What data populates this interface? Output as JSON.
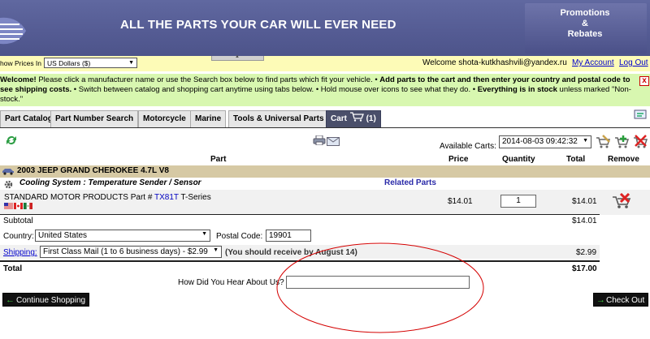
{
  "header": {
    "headline": "ALL THE PARTS YOUR CAR WILL EVER NEED",
    "promo": [
      "Promotions",
      "&",
      "Rebates"
    ]
  },
  "topbar": {
    "show_prices_label": "how Prices In",
    "currency_value": "US Dollars ($)",
    "welcome": "Welcome shota-kutkhashvili@yandex.ru",
    "my_account": "My Account",
    "log_out": "Log Out"
  },
  "banner": {
    "welcome_bold": "Welcome!",
    "text1": " Please click a manufacturer name or use the Search box below to find parts which fit your vehicle. • ",
    "bold2": "Add parts to the cart and then enter your country and postal code to see shipping costs.",
    "text2": " • Switch between catalog and shopping cart anytime using tabs below. • Hold mouse over icons to see what they do. • ",
    "bold3": "Everything is in stock",
    "text3": " unless marked \"Non-stock.\"",
    "close": "x"
  },
  "tabs": [
    "Part Catalog",
    "Part Number Search",
    "Motorcycle",
    "Marine",
    "Tools & Universal Parts"
  ],
  "cart_tab": {
    "label": "Cart",
    "count": "(1)"
  },
  "cart": {
    "available_label": "Available Carts:",
    "selected_cart": "2014-08-03 09:42:32"
  },
  "columns": {
    "part": "Part",
    "price": "Price",
    "quantity": "Quantity",
    "total": "Total",
    "remove": "Remove"
  },
  "vehicle": "2003 JEEP GRAND CHEROKEE 4.7L V8",
  "category": "Cooling System : Temperature Sender / Sensor",
  "related_parts": "Related Parts",
  "item": {
    "prefix": "STANDARD MOTOR PRODUCTS Part # ",
    "part_number": "TX81T",
    "suffix": " T-Series",
    "price": "$14.01",
    "quantity": "1",
    "total": "$14.01"
  },
  "subtotal": {
    "label": "Subtotal",
    "value": "$14.01"
  },
  "country": {
    "label": "Country:",
    "value": "United States"
  },
  "postal": {
    "label": "Postal Code:",
    "value": "19901"
  },
  "shipping": {
    "label": "Shipping:",
    "method": "First Class Mail (1 to 6 business days) - $2.99",
    "note": "(You should receive by August 14)",
    "price": "$2.99"
  },
  "total": {
    "label": "Total",
    "value": "$17.00"
  },
  "hear_about": {
    "label": "How Did You Hear About Us?",
    "value": ""
  },
  "buttons": {
    "continue": "Continue Shopping",
    "checkout": "Check Out"
  },
  "colors": {
    "header": "#545b93",
    "topbar": "#fdfbb7",
    "banner": "#d8f7b0",
    "vehicle_row": "#d6c9a4",
    "annotation": "#d40000"
  }
}
